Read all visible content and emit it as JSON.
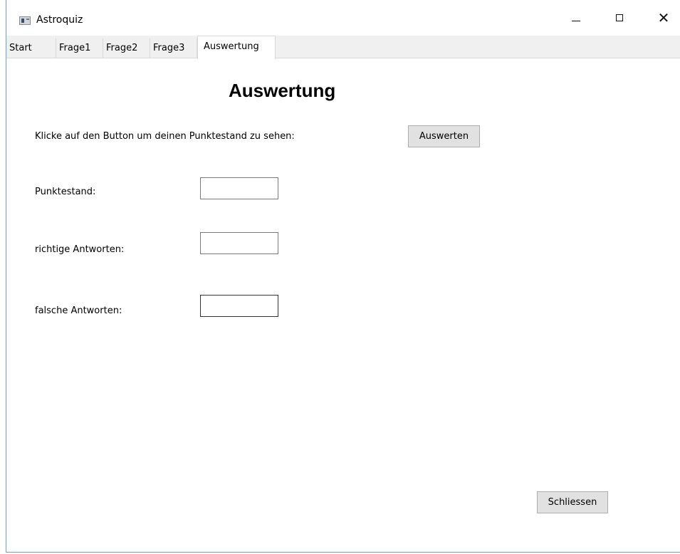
{
  "window": {
    "title": "Astroquiz",
    "controls": {
      "minimize": "—",
      "maximize": "☐",
      "close": "✕"
    }
  },
  "tabs": [
    {
      "label": "Start",
      "active": false
    },
    {
      "label": "Frage1",
      "active": false
    },
    {
      "label": "Frage2",
      "active": false
    },
    {
      "label": "Frage3",
      "active": false
    },
    {
      "label": "Auswertung",
      "active": true
    }
  ],
  "main": {
    "heading": "Auswertung",
    "instruction": "Klicke auf den Button um deinen Punktestand zu sehen:",
    "evaluate_button": "Auswerten",
    "score_label": "Punktestand:",
    "score_value": "",
    "correct_label": "richtige Antworten:",
    "correct_value": "",
    "wrong_label": "falsche Antworten:",
    "wrong_value": "",
    "close_button": "Schliessen"
  }
}
